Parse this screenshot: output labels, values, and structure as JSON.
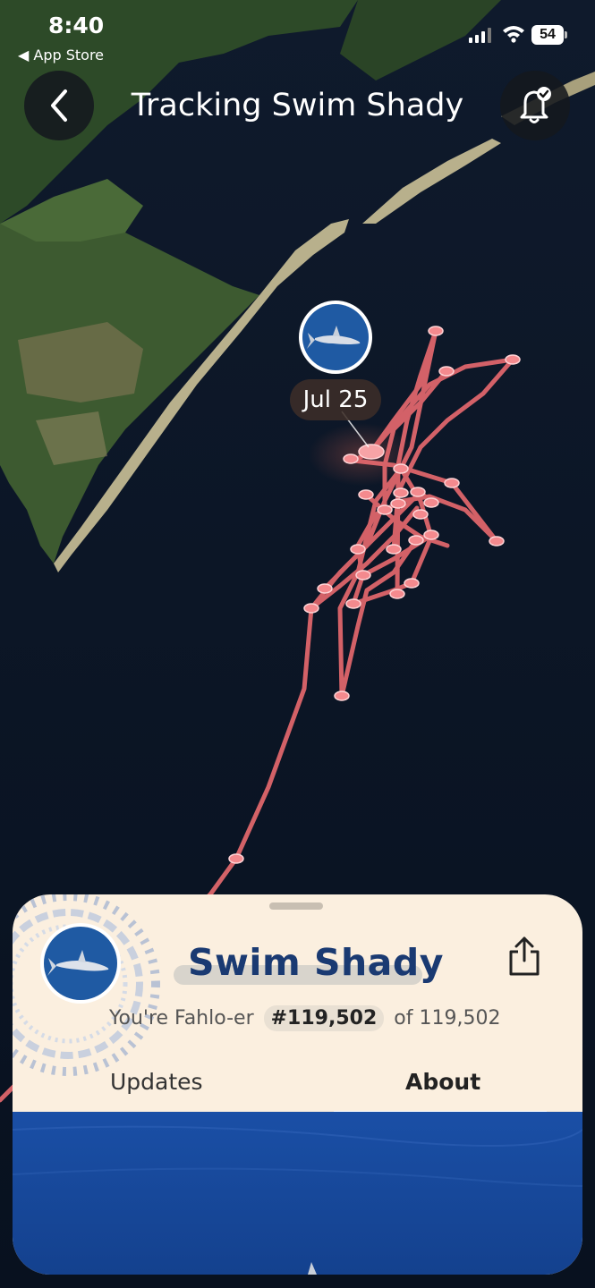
{
  "status_bar": {
    "time": "8:40",
    "back_to_app": "◀ App Store",
    "battery": "54"
  },
  "header": {
    "title": "Tracking Swim Shady"
  },
  "map": {
    "latest_ping_label": "Jul 25",
    "track_color": "#e96a6f",
    "land_color": "#3d5a2e",
    "ocean_color": "#0b1526"
  },
  "profile": {
    "name": "Swim Shady",
    "rank_prefix": "You're Fahlo-er",
    "rank": "#119,502",
    "rank_suffix": "of 119,502"
  },
  "tabs": [
    {
      "label": "Updates",
      "selected": false
    },
    {
      "label": "About",
      "selected": true
    }
  ],
  "colors": {
    "sheet_bg": "#fbefdf",
    "name_color": "#1a3a72",
    "accent_track": "#e96a6f"
  }
}
